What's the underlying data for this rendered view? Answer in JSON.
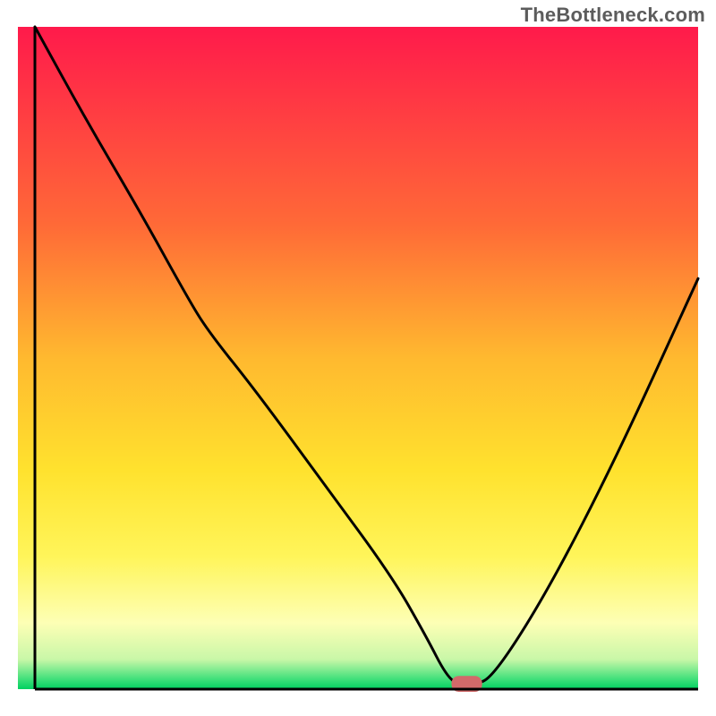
{
  "watermark": "TheBottleneck.com",
  "chart_data": {
    "type": "line",
    "title": "",
    "xlabel": "",
    "ylabel": "",
    "xlim": [
      0,
      100
    ],
    "ylim": [
      0,
      100
    ],
    "grid": false,
    "gradient_stops": [
      {
        "offset": 0.0,
        "color": "#ff1a4b"
      },
      {
        "offset": 0.3,
        "color": "#ff6a37"
      },
      {
        "offset": 0.5,
        "color": "#ffb92f"
      },
      {
        "offset": 0.67,
        "color": "#ffe22e"
      },
      {
        "offset": 0.8,
        "color": "#fff55a"
      },
      {
        "offset": 0.9,
        "color": "#fdffb5"
      },
      {
        "offset": 0.955,
        "color": "#c9f7a8"
      },
      {
        "offset": 0.985,
        "color": "#3fe07a"
      },
      {
        "offset": 1.0,
        "color": "#00d060"
      }
    ],
    "series": [
      {
        "name": "bottleneck-curve",
        "color": "#000000",
        "x": [
          2.5,
          10,
          18,
          25,
          28,
          35,
          45,
          55,
          60,
          63,
          65,
          67,
          70,
          78,
          88,
          100
        ],
        "y": [
          100,
          86,
          72,
          59,
          54,
          45,
          31,
          17,
          8,
          2,
          0.5,
          0.5,
          2,
          15,
          35,
          62
        ]
      }
    ],
    "marker": {
      "name": "optimum-marker",
      "x": 66,
      "y": 0,
      "color": "#d26a6a",
      "width": 4.5,
      "height": 2.4
    },
    "frame": {
      "left_x": 2.5,
      "bottom_y": 0,
      "color": "#000000",
      "width": 3
    }
  }
}
